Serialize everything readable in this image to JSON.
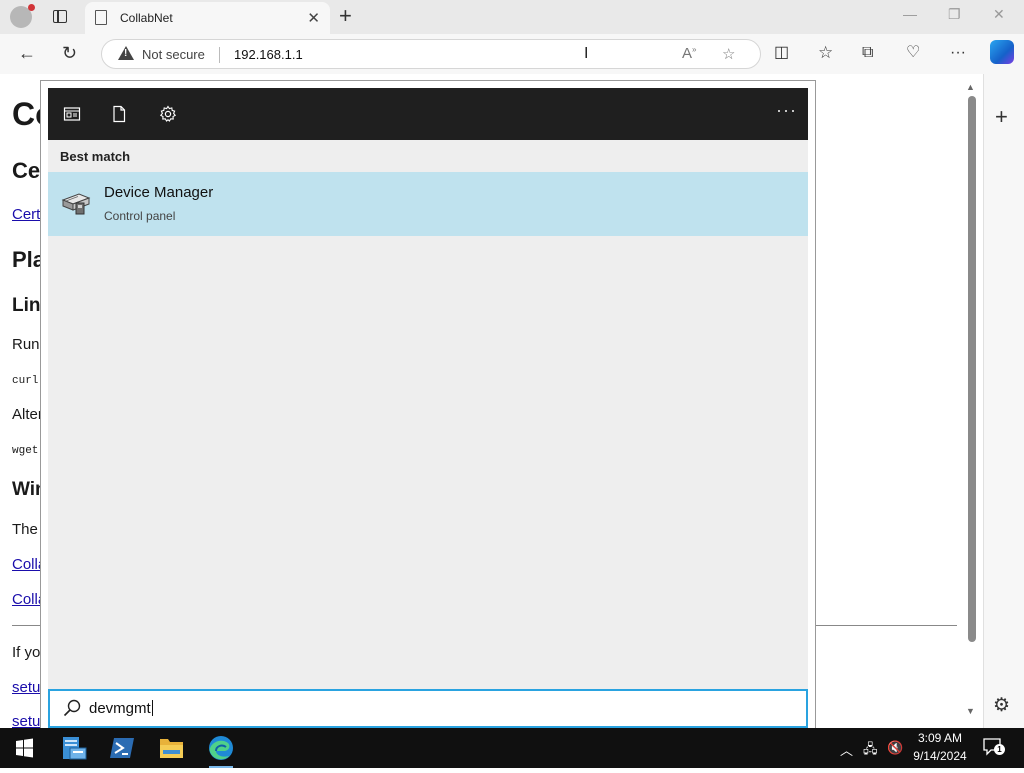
{
  "browser": {
    "tab": {
      "title": "CollabNet"
    },
    "address": {
      "security_label": "Not secure",
      "url": "192.168.1.1"
    }
  },
  "page": {
    "lines": [
      {
        "kind": "h1",
        "text": "Co"
      },
      {
        "kind": "h2",
        "text": "Cer"
      },
      {
        "kind": "link",
        "text": "Certi"
      },
      {
        "kind": "h2",
        "text": "Pla"
      },
      {
        "kind": "h3",
        "text": "Linu"
      },
      {
        "kind": "p",
        "text": "Run t"
      },
      {
        "kind": "code",
        "text": "curl"
      },
      {
        "kind": "p",
        "text": "Alter"
      },
      {
        "kind": "code",
        "text": "wget"
      },
      {
        "kind": "h3",
        "text": "Win"
      },
      {
        "kind": "p",
        "text": "The fo"
      },
      {
        "kind": "link",
        "text": "Colla"
      },
      {
        "kind": "link",
        "text": "Colla"
      },
      {
        "kind": "p",
        "text": "If you"
      },
      {
        "kind": "link",
        "text": "setup"
      },
      {
        "kind": "link",
        "text": "setup"
      }
    ]
  },
  "search": {
    "section_label": "Best match",
    "result": {
      "title": "Device Manager",
      "subtitle": "Control panel"
    },
    "query": "devmgmt",
    "more_label": "···"
  },
  "taskbar": {
    "clock": {
      "time": "3:09 AM",
      "date": "9/14/2024"
    },
    "notification_count": "1"
  },
  "colors": {
    "accent": "#2aa3e0",
    "result_highlight": "#bfe2ee",
    "taskbar": "#101010",
    "panel_header": "#1f1f1f"
  }
}
